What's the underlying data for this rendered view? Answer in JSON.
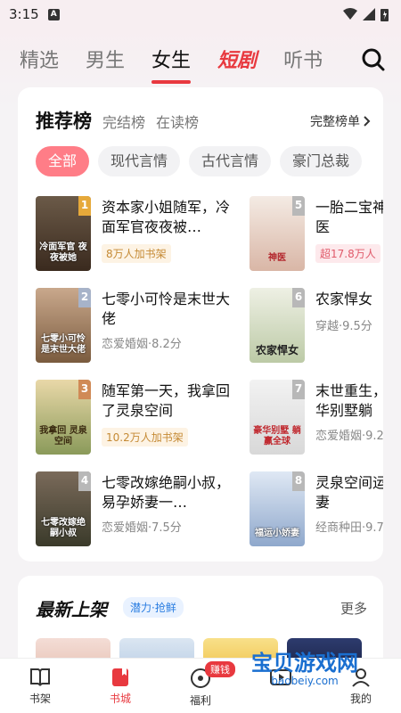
{
  "status": {
    "time": "3:15",
    "a_icon": "A"
  },
  "tabs": [
    "精选",
    "男生",
    "女生",
    "短剧",
    "听书"
  ],
  "rank": {
    "title": "推荐榜",
    "subs": [
      "完结榜",
      "在读榜"
    ],
    "full_list": "完整榜单"
  },
  "chips": [
    "全部",
    "现代言情",
    "古代言情",
    "豪门总裁"
  ],
  "books": [
    {
      "rank": "1",
      "title": "资本家小姐随军，冷面军官夜夜被…",
      "tag": "8万人加书架",
      "meta": "",
      "cover_text": "冷面军官 夜夜被她"
    },
    {
      "rank": "2",
      "title": "七零小可怜是末世大佬",
      "tag": "",
      "meta": "恋爱婚姻·8.2分",
      "cover_text": "七零小可怜 是末世大佬"
    },
    {
      "rank": "3",
      "title": "随军第一天，我拿回了灵泉空间",
      "tag": "10.2万人加书架",
      "meta": "",
      "cover_text": "我拿回 灵泉空间"
    },
    {
      "rank": "4",
      "title": "七零改嫁绝嗣小叔，易孕娇妻一…",
      "tag": "",
      "meta": "恋爱婚姻·7.5分",
      "cover_text": "七零改嫁绝嗣小叔"
    },
    {
      "rank": "5",
      "title": "一胎二宝神医",
      "tag": "超17.8万人",
      "meta": "",
      "cover_text": "神医"
    },
    {
      "rank": "6",
      "title": "农家悍女",
      "tag": "",
      "meta": "穿越·9.5分",
      "cover_text": "农家悍女"
    },
    {
      "rank": "7",
      "title": "末世重生，华别墅躺",
      "tag": "",
      "meta": "恋爱婚姻·9.2",
      "cover_text": "豪华别墅 躺赢全球"
    },
    {
      "rank": "8",
      "title": "灵泉空间运妻",
      "tag": "",
      "meta": "经商种田·9.7",
      "cover_text": "福运小娇妻"
    }
  ],
  "new_section": {
    "title": "最新上架",
    "badge": "潜力·抢鲜",
    "more": "更多"
  },
  "nav": {
    "items": [
      {
        "label": "书架",
        "icon": "book-icon"
      },
      {
        "label": "书城",
        "icon": "bookmark-icon"
      },
      {
        "label": "福利",
        "icon": "gift-icon"
      },
      {
        "label": "",
        "icon": "video-icon"
      },
      {
        "label": "我的",
        "icon": "user-icon"
      }
    ],
    "earn_badge": "赚钱"
  },
  "watermark": {
    "main": "宝贝游戏网",
    "sub": "baobeiy.com"
  },
  "colors": {
    "accent": "#e8393f",
    "chip_active": "#ff7d87"
  }
}
